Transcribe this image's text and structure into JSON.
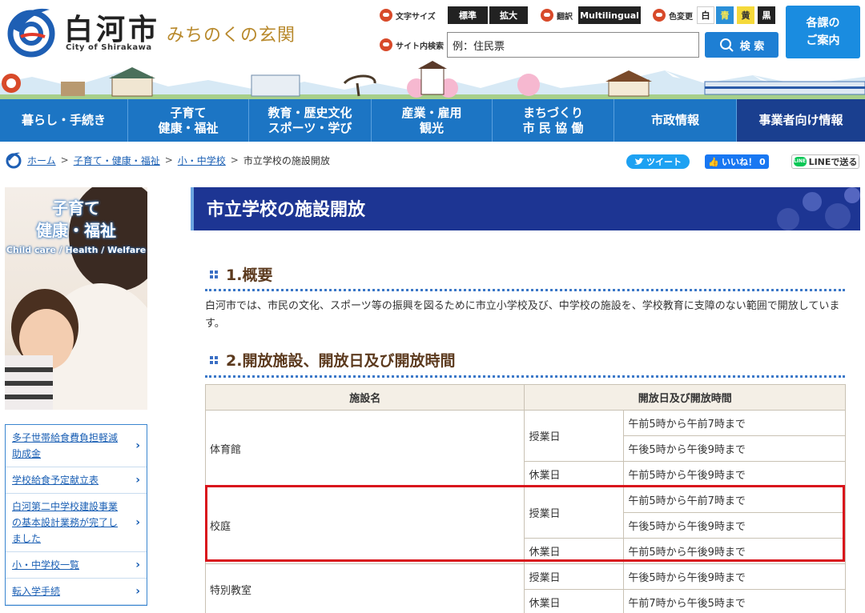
{
  "header": {
    "city_name": "白河市",
    "city_name_en": "City of Shirakawa",
    "tagline": "みちのくの玄関",
    "text_size_label": "文字サイズ",
    "text_size_standard": "標準",
    "text_size_large": "拡大",
    "translate_label": "翻訳",
    "multilingual": "Multilingual",
    "color_change_label": "色変更",
    "color_options": [
      "白",
      "青",
      "黄",
      "黒"
    ],
    "search_label": "サイト内検索",
    "search_value": "例：住民票",
    "search_button": "検 索",
    "guide_button": "各課の\nご案内"
  },
  "nav": {
    "items": [
      "暮らし・手続き",
      "子育て\n健康・福祉",
      "教育・歴史文化\nスポーツ・学び",
      "産業・雇用\n観光",
      "まちづくり\n市 民 協 働",
      "市政情報",
      "事業者向け情報"
    ]
  },
  "breadcrumb": {
    "home": "ホーム",
    "level1": "子育て・健康・福祉",
    "level2": "小・中学校",
    "current": "市立学校の施設開放",
    "sep": ">"
  },
  "social": {
    "tweet": "ツイート",
    "like": "いいね！",
    "like_count": "0",
    "line": "LINEで送る"
  },
  "sidebar": {
    "banner_title_1": "子育て",
    "banner_title_2": "健康・福祉",
    "banner_en": "Child care / Health / Welfare",
    "links": [
      "多子世帯給食費負担軽減\n助成金",
      "学校給食予定献立表",
      "白河第二中学校建設事業\nの基本設計業務が完了し\nました",
      "小・中学校一覧",
      "転入学手続"
    ]
  },
  "main": {
    "page_title": "市立学校の施設開放",
    "section1_title": "1.概要",
    "intro": "白河市では、市民の文化、スポーツ等の振興を図るために市立小学校及び、中学校の施設を、学校教育に支障のない範囲で開放しています。",
    "section2_title": "2.開放施設、開放日及び開放時間",
    "table": {
      "col_facility": "施設名",
      "col_time": "開放日及び開放時間",
      "gym": "体育館",
      "yard": "校庭",
      "special": "特別教室",
      "class_day": "授業日",
      "holiday": "休業日",
      "t_5am_7am": "午前5時から午前7時まで",
      "t_5pm_9pm": "午後5時から午後9時まで",
      "t_5am_9pm": "午前5時から午後9時まで",
      "t_7am_5pm": "午前7時から午後5時まで"
    }
  },
  "colors": {
    "nav_bg": "#1c75c4",
    "nav_last_bg": "#1a3f8f",
    "title_bar": "#1d3593",
    "heading": "#5c3a1e",
    "highlight": "#d9141c"
  }
}
